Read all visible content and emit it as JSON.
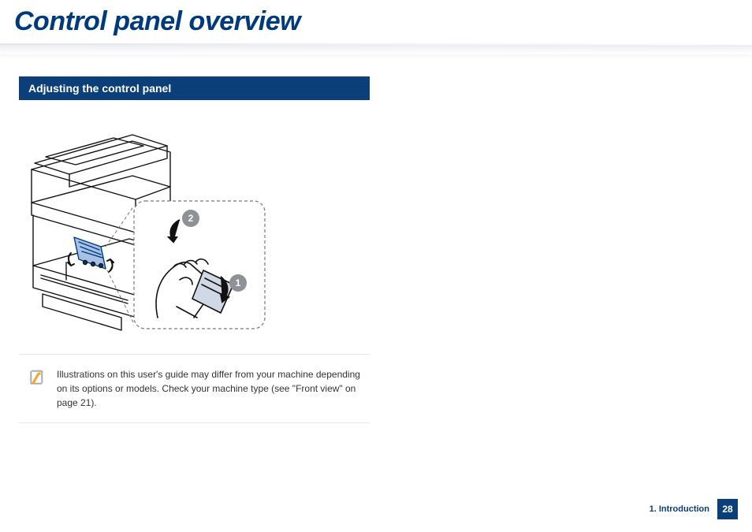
{
  "page": {
    "title": "Control panel overview"
  },
  "section": {
    "heading": "Adjusting the control panel"
  },
  "callouts": {
    "one": "1",
    "two": "2"
  },
  "note": {
    "text": "Illustrations on this user's guide may differ from your machine depending on its options or models. Check your machine type (see \"Front view\" on page 21)."
  },
  "footer": {
    "chapter": "1.  Introduction",
    "page_number": "28"
  }
}
